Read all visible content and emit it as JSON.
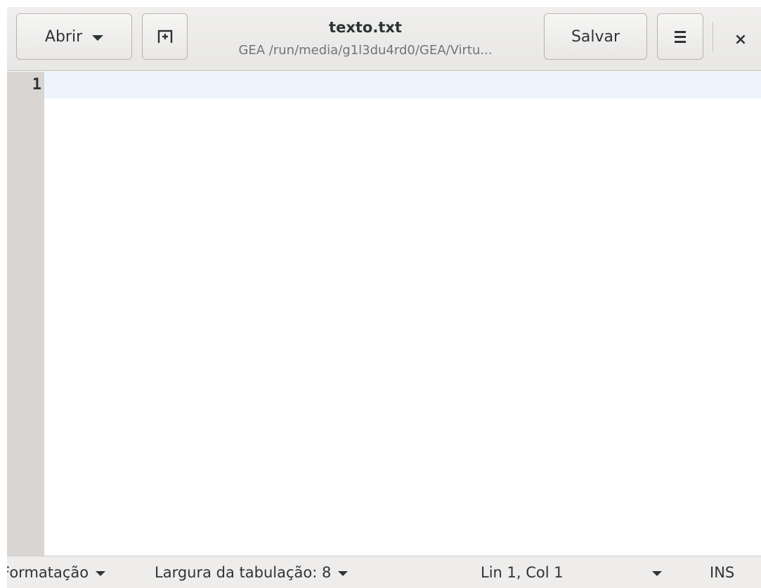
{
  "window": {
    "title": "texto.txt",
    "subtitle": "GEA /run/media/g1l3du4rd0/GEA/Virtu..."
  },
  "headerbar": {
    "open_label": "Abrir",
    "new_tab_icon": "new-tab-icon",
    "save_label": "Salvar",
    "menu_icon": "hamburger-menu-icon",
    "close_glyph": "×"
  },
  "editor": {
    "line_numbers": [
      "1"
    ],
    "content": "",
    "current_line_color": "#eef4fc",
    "gutter_color": "#d9d5d2"
  },
  "statusbar": {
    "format_label": "Formatação",
    "tab_width_label": "Largura da tabulação: 8",
    "position_label": "Lin 1, Col 1",
    "insert_mode_label": "INS"
  }
}
